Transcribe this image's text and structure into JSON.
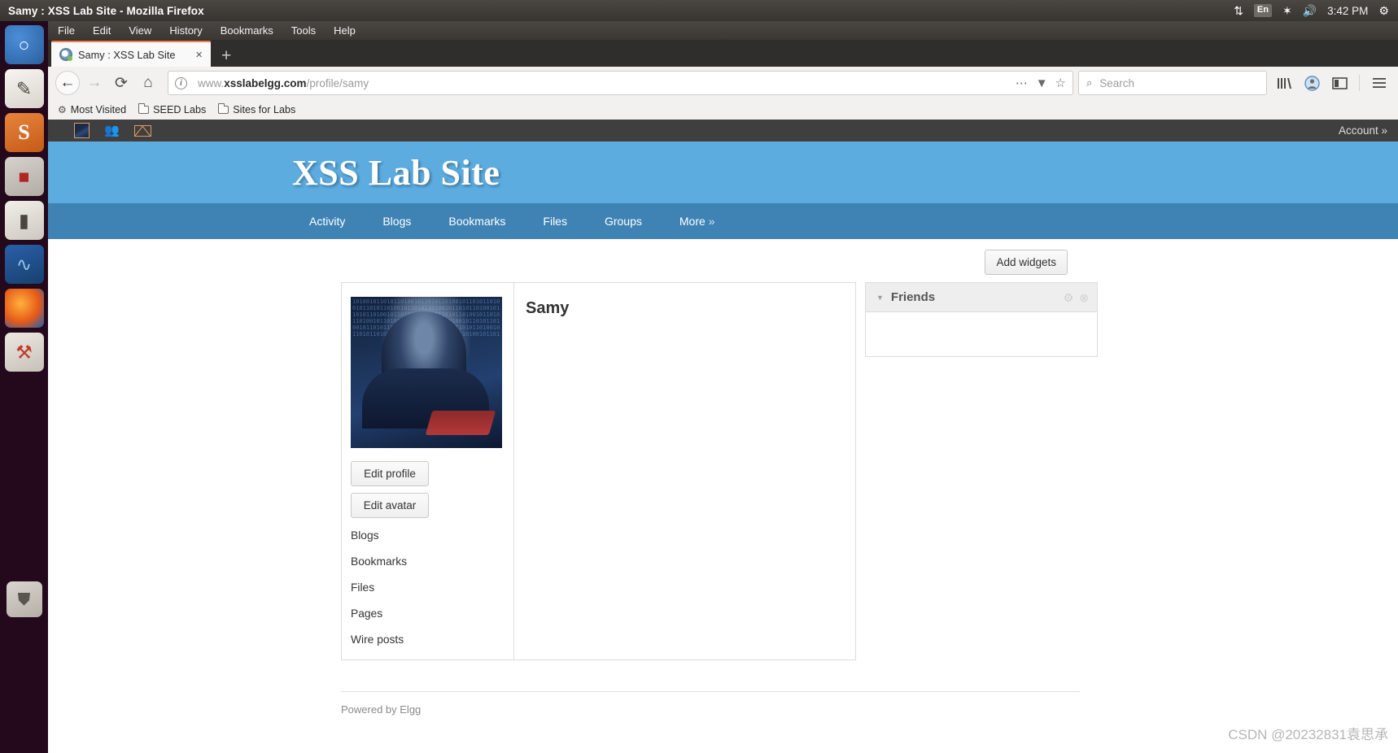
{
  "system": {
    "window_title": "Samy : XSS Lab Site - Mozilla Firefox",
    "tray": {
      "network_icon": "⇅",
      "keyboard_layout": "En",
      "bluetooth_icon": "✶",
      "volume_icon": "🔊",
      "clock": "3:42 PM",
      "power_icon": "⚙"
    },
    "launcher": [
      {
        "name": "ubuntu-dash",
        "glyph": ""
      },
      {
        "name": "files-manager",
        "glyph": "✎"
      },
      {
        "name": "seed-app",
        "glyph": "S"
      },
      {
        "name": "software-center",
        "glyph": "■"
      },
      {
        "name": "terminal",
        "glyph": "⬜"
      },
      {
        "name": "wireshark",
        "glyph": "∿"
      },
      {
        "name": "firefox",
        "glyph": ""
      },
      {
        "name": "system-tools",
        "glyph": "⚒"
      },
      {
        "name": "trash",
        "glyph": "🗑"
      }
    ]
  },
  "browser": {
    "menus": [
      "File",
      "Edit",
      "View",
      "History",
      "Bookmarks",
      "Tools",
      "Help"
    ],
    "tab": {
      "title": "Samy : XSS Lab Site",
      "close": "×"
    },
    "new_tab": "+",
    "nav": {
      "back": "←",
      "forward": "→",
      "reload": "⟳",
      "home": "⌂"
    },
    "url": {
      "prefix": "www.",
      "domain": "xsslabelgg.com",
      "path": "/profile/samy"
    },
    "url_icons": {
      "page_info": "i",
      "more": "⋯",
      "pocket": "▼",
      "bookmark_star": "☆"
    },
    "search": {
      "placeholder": "Search",
      "icon": "⌕"
    },
    "right_icons": [
      "library-icon",
      "account-icon",
      "sidebar-icon",
      "menu-icon"
    ],
    "bookmarks": [
      {
        "label": "Most Visited",
        "icon": "gear-icon"
      },
      {
        "label": "SEED Labs",
        "icon": "folder-icon"
      },
      {
        "label": "Sites for Labs",
        "icon": "folder-icon"
      }
    ]
  },
  "site": {
    "topbar": {
      "avatar_icon": "user-avatar-icon",
      "friends_icon": "people-icon",
      "messages_icon": "envelope-icon",
      "account": "Account  »"
    },
    "title": "XSS Lab Site",
    "nav": [
      {
        "label": "Activity"
      },
      {
        "label": "Blogs"
      },
      {
        "label": "Bookmarks"
      },
      {
        "label": "Files"
      },
      {
        "label": "Groups"
      },
      {
        "label": "More",
        "chevron": "»"
      }
    ],
    "add_widgets_label": "Add widgets",
    "profile": {
      "display_name": "Samy",
      "buttons": [
        "Edit profile",
        "Edit avatar"
      ],
      "links": [
        "Blogs",
        "Bookmarks",
        "Files",
        "Pages",
        "Wire posts"
      ]
    },
    "widgets": [
      {
        "title": "Friends",
        "caret": "▼",
        "settings_icon": "⚙",
        "close_icon": "⊗",
        "friends": [
          {
            "name": "friend-avatar"
          }
        ]
      }
    ],
    "footer": "Powered by Elgg"
  },
  "watermark": "CSDN @20232831袁思承",
  "colors": {
    "banner": "#5cace0",
    "nav": "#3f83b5",
    "topbar_dark": "#3f3f3f",
    "tab_accent": "#f0804a"
  }
}
